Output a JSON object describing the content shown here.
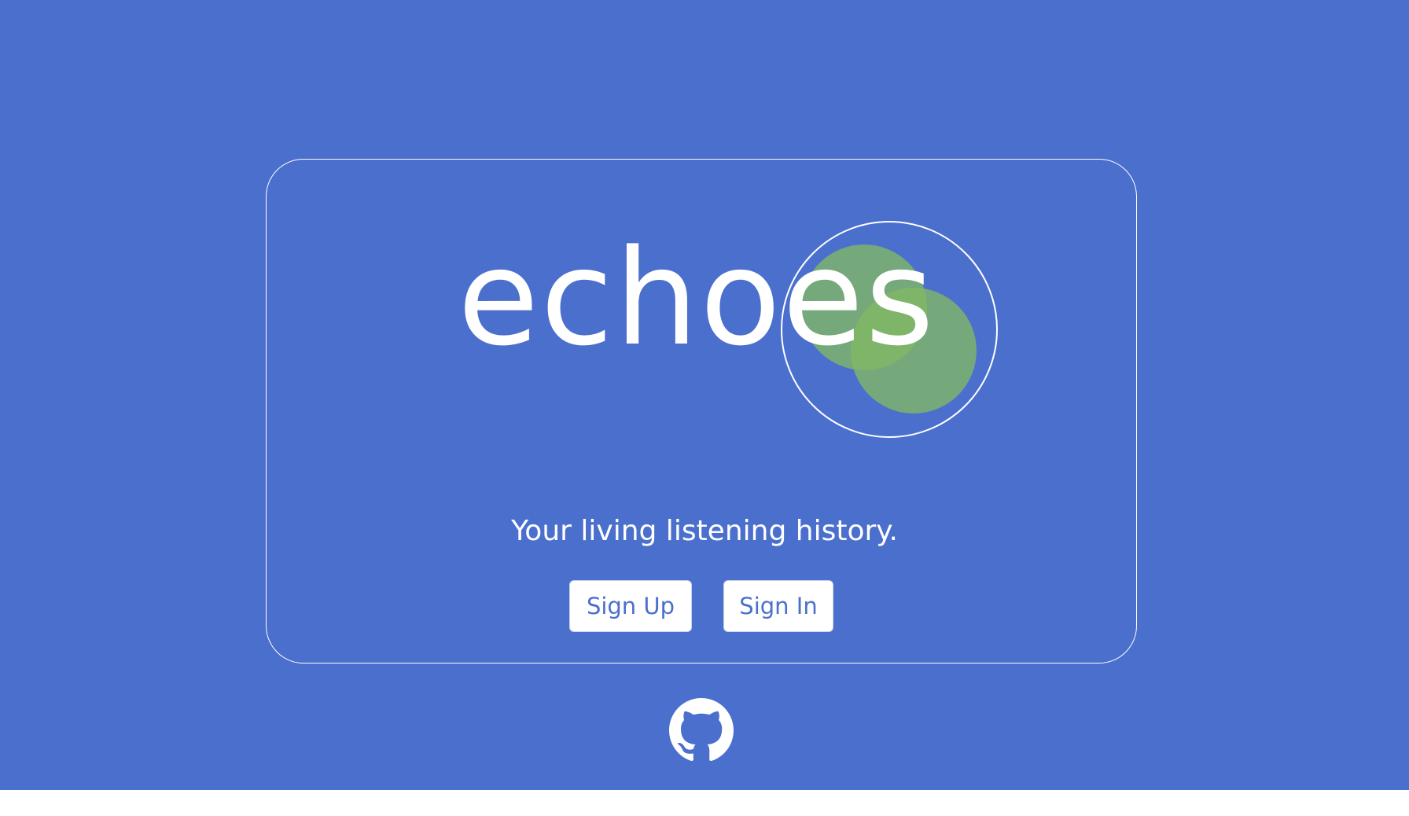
{
  "brand": {
    "wordmark": "echoes",
    "tagline": "Your living listening history."
  },
  "actions": {
    "sign_up_label": "Sign Up",
    "sign_in_label": "Sign In"
  },
  "footer": {
    "link_icon": "github-icon"
  },
  "colors": {
    "background": "#4b6fcd",
    "accent_green": "#82b864",
    "text": "#ffffff",
    "button_text": "#4b6fcd"
  }
}
